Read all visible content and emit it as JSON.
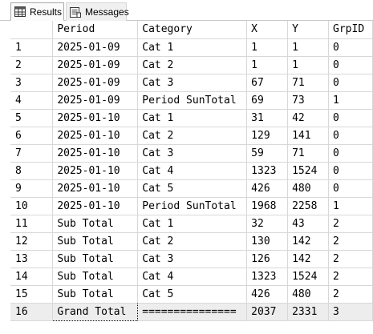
{
  "tabs": [
    {
      "label": "Results",
      "icon": "grid-icon",
      "active": true
    },
    {
      "label": "Messages",
      "icon": "messages-icon",
      "active": false
    }
  ],
  "grid": {
    "columns": [
      "",
      "Period",
      "Category",
      "X",
      "Y",
      "GrpID"
    ],
    "rows": [
      [
        "1",
        "2025-01-09",
        "Cat 1",
        "1",
        "1",
        "0"
      ],
      [
        "2",
        "2025-01-09",
        "Cat 2",
        "1",
        "1",
        "0"
      ],
      [
        "3",
        "2025-01-09",
        "Cat 3",
        "67",
        "71",
        "0"
      ],
      [
        "4",
        "2025-01-09",
        "Period SunTotal",
        "69",
        "73",
        "1"
      ],
      [
        "5",
        "2025-01-10",
        "Cat 1",
        "31",
        "42",
        "0"
      ],
      [
        "6",
        "2025-01-10",
        "Cat 2",
        "129",
        "141",
        "0"
      ],
      [
        "7",
        "2025-01-10",
        "Cat 3",
        "59",
        "71",
        "0"
      ],
      [
        "8",
        "2025-01-10",
        "Cat 4",
        "1323",
        "1524",
        "0"
      ],
      [
        "9",
        "2025-01-10",
        "Cat 5",
        "426",
        "480",
        "0"
      ],
      [
        "10",
        "2025-01-10",
        "Period SunTotal",
        "1968",
        "2258",
        "1"
      ],
      [
        "11",
        "Sub Total",
        "Cat 1",
        "32",
        "43",
        "2"
      ],
      [
        "12",
        "Sub Total",
        "Cat 2",
        "130",
        "142",
        "2"
      ],
      [
        "13",
        "Sub Total",
        "Cat 3",
        "126",
        "142",
        "2"
      ],
      [
        "14",
        "Sub Total",
        "Cat 4",
        "1323",
        "1524",
        "2"
      ],
      [
        "15",
        "Sub Total",
        "Cat 5",
        "426",
        "480",
        "2"
      ],
      [
        "16",
        "Grand Total",
        "===============",
        "2037",
        "2331",
        "3"
      ]
    ]
  }
}
